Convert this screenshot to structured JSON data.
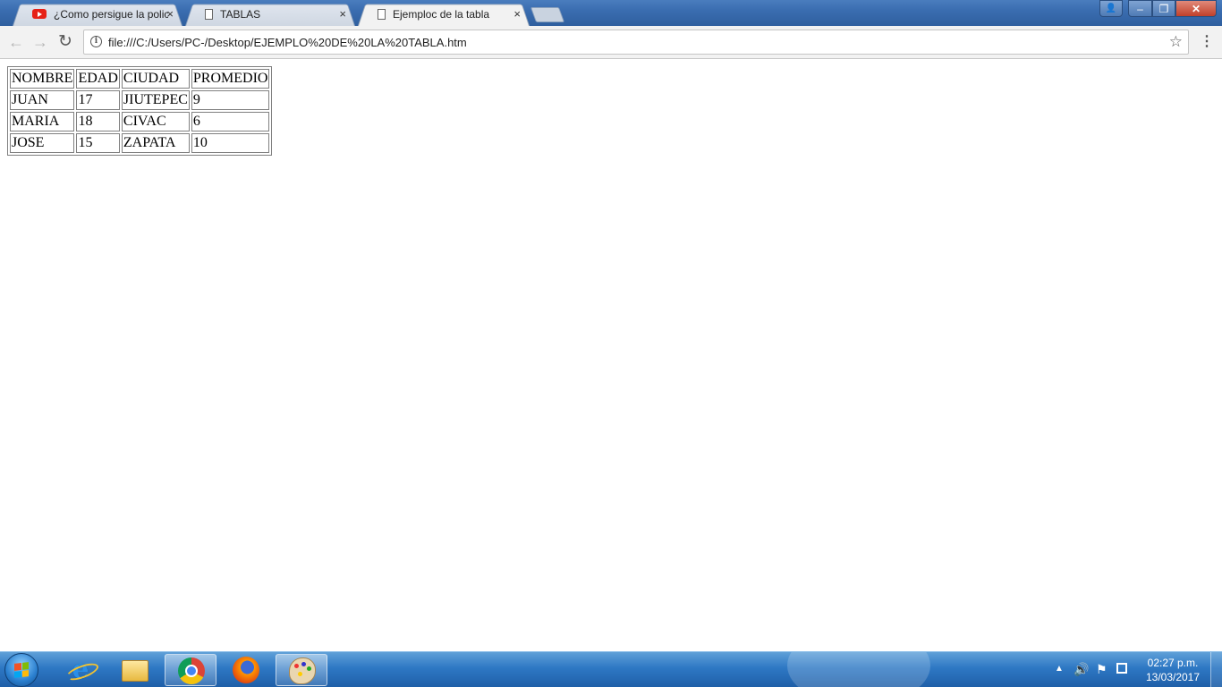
{
  "browser": {
    "tabs": [
      {
        "label": "¿Como persigue la polici",
        "icon": "youtube-icon",
        "active": false
      },
      {
        "label": "TABLAS",
        "icon": "document-icon",
        "active": false
      },
      {
        "label": "Ejemploc de la tabla",
        "icon": "document-icon",
        "active": true
      }
    ],
    "close_glyph": "×",
    "address_bar": {
      "url": "file:///C:/Users/PC-/Desktop/EJEMPLO%20DE%20LA%20TABLA.htm"
    },
    "window_controls": {
      "minimize": "–",
      "maximize": "❐",
      "close": "✕",
      "user": "👤"
    },
    "nav": {
      "back": "←",
      "forward": "→",
      "reload": "↻",
      "bookmark": "☆",
      "menu": "⋮",
      "info": "i"
    }
  },
  "table": {
    "headers": [
      "NOMBRE",
      "EDAD",
      "CIUDAD",
      "PROMEDIO"
    ],
    "rows": [
      [
        "JUAN",
        "17",
        "JIUTEPEC",
        "9"
      ],
      [
        "MARIA",
        "18",
        "CIVAC",
        "6"
      ],
      [
        "JOSE",
        "15",
        "ZAPATA",
        "10"
      ]
    ]
  },
  "taskbar": {
    "apps": [
      "internet-explorer-icon",
      "file-explorer-icon",
      "chrome-icon",
      "firefox-icon",
      "paint-icon"
    ],
    "tray": {
      "show_hidden": "▲",
      "volume": "🔊",
      "action_center": "⚑"
    },
    "clock": {
      "time": "02:27 p.m.",
      "date": "13/03/2017"
    }
  },
  "colors": {
    "taskbar": "#2e78c4",
    "titlebar": "#3a6db0",
    "close_button": "#c2402a"
  }
}
